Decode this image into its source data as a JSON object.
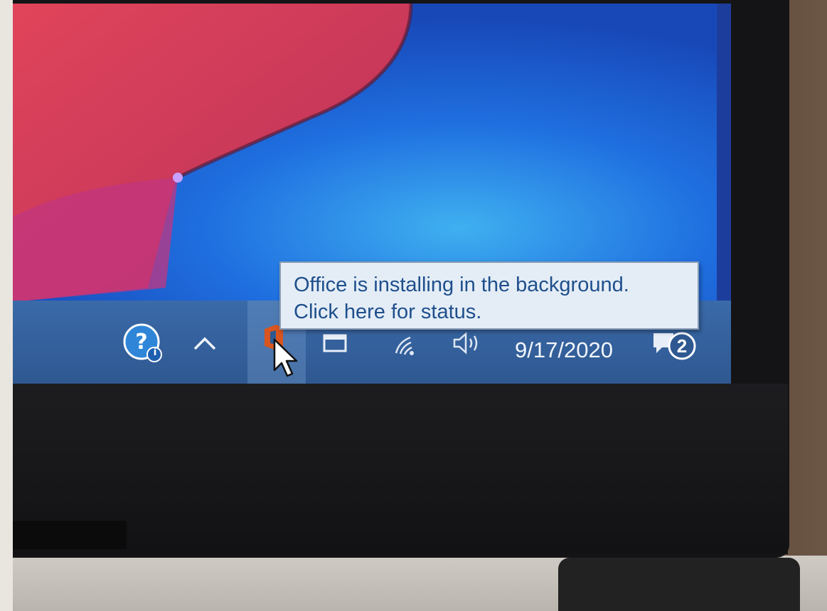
{
  "tooltip": {
    "line1": "Office is installing in the background.",
    "line2": "Click here for status."
  },
  "taskbar": {
    "date": "9/17/2020",
    "notification_count": "2",
    "help_badge": "i"
  },
  "icons": {
    "help": "help-question-icon",
    "chevron": "chevron-up-icon",
    "office": "office-logo-icon",
    "window": "window-icon",
    "wifi": "wifi-icon",
    "volume": "volume-icon",
    "notifications": "notification-center-icon",
    "cursor": "mouse-pointer-icon"
  },
  "colors": {
    "taskbar": "#2f5891",
    "tooltip_bg": "#e4edf6",
    "tooltip_text": "#1f4f8c",
    "office_orange": "#d8551f",
    "wallpaper_red": "#d6404f",
    "wallpaper_blue": "#1f6fe0"
  }
}
